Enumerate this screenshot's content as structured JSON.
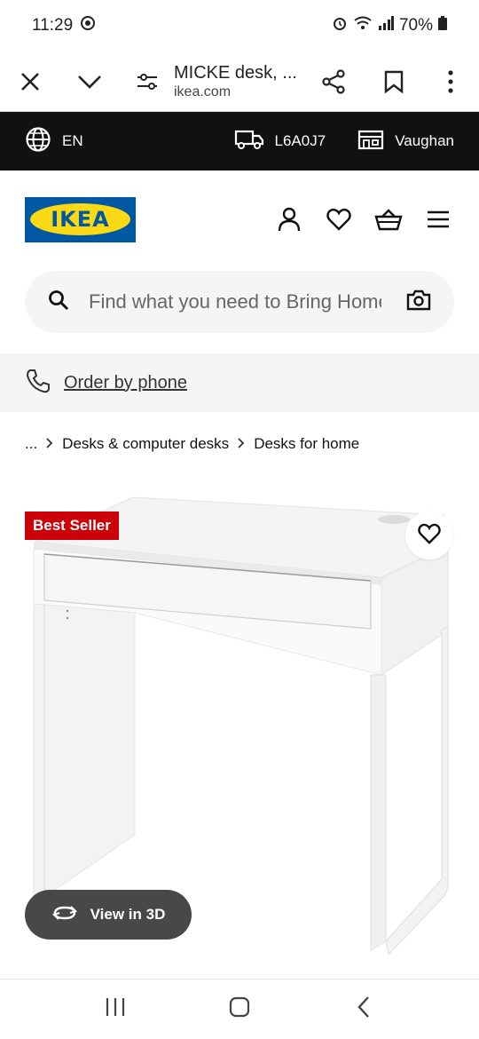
{
  "status": {
    "time": "11:29",
    "battery": "70%"
  },
  "browser": {
    "title": "MICKE desk, ...",
    "url": "ikea.com"
  },
  "prefs": {
    "language": "EN",
    "postal_code": "L6A0J7",
    "store": "Vaughan"
  },
  "header": {
    "logo_text": "IKEA"
  },
  "search": {
    "placeholder": "Find what you need to Bring Home"
  },
  "phone": {
    "label": "Order by phone"
  },
  "breadcrumb": {
    "ellipsis": "...",
    "items": [
      "Desks & computer desks",
      "Desks for home"
    ]
  },
  "product": {
    "badge": "Best Seller",
    "view3d_label": "View in 3D"
  },
  "colors": {
    "ikea_blue": "#0058a3",
    "ikea_yellow": "#fbd914",
    "badge_red": "#cc0008"
  }
}
